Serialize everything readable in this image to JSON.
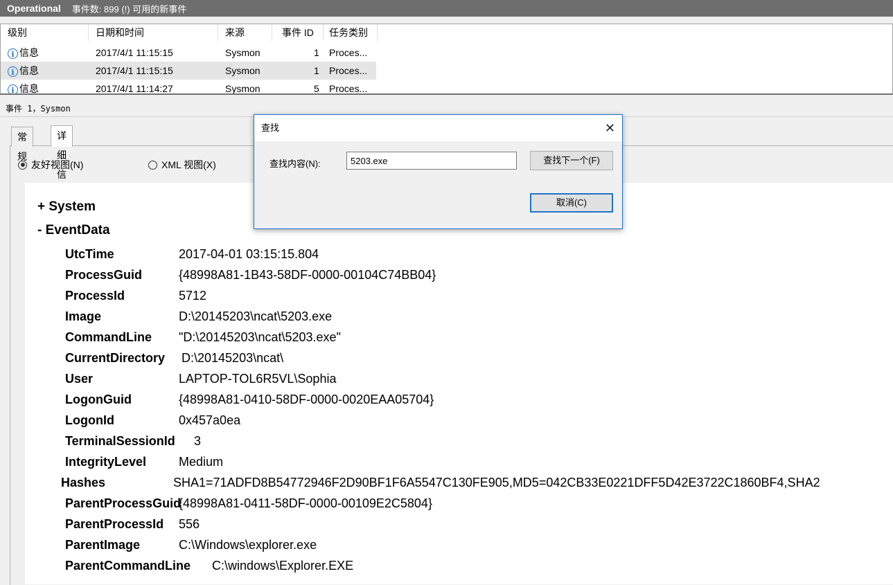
{
  "titlebar": {
    "log_name": "Operational",
    "summary": "事件数: 899 (!) 可用的新事件"
  },
  "list": {
    "columns": [
      "级别",
      "日期和时间",
      "来源",
      "事件 ID",
      "任务类别"
    ],
    "rows": [
      {
        "level": "信息",
        "datetime": "2017/4/1 11:15:15",
        "source": "Sysmon",
        "id": "1",
        "task": "Proces..."
      },
      {
        "level": "信息",
        "datetime": "2017/4/1 11:15:15",
        "source": "Sysmon",
        "id": "1",
        "task": "Proces..."
      },
      {
        "level": "信息",
        "datetime": "2017/4/1 11:14:27",
        "source": "Sysmon",
        "id": "5",
        "task": "Proces..."
      }
    ]
  },
  "detail": {
    "header": "事件 1，Sysmon",
    "tabs": [
      "常规",
      "详细信息"
    ],
    "views": {
      "friendly": "友好视图(N)",
      "xml": "XML 视图(X)"
    },
    "sections": {
      "system": "+ System",
      "eventdata": "-  EventData"
    },
    "fields": [
      {
        "k": "UtcTime",
        "v": "2017-04-01 03:15:15.804"
      },
      {
        "k": "ProcessGuid",
        "v": "{48998A81-1B43-58DF-0000-00104C74BB04}"
      },
      {
        "k": "ProcessId",
        "v": "5712"
      },
      {
        "k": "Image",
        "v": "D:\\20145203\\ncat\\5203.exe"
      },
      {
        "k": "CommandLine",
        "v": "\"D:\\20145203\\ncat\\5203.exe\""
      },
      {
        "k": "CurrentDirectory",
        "v": "D:\\20145203\\ncat\\"
      },
      {
        "k": "User",
        "v": "LAPTOP-TOL6R5VL\\Sophia"
      },
      {
        "k": "LogonGuid",
        "v": "{48998A81-0410-58DF-0000-0020EAA05704}"
      },
      {
        "k": "LogonId",
        "v": "0x457a0ea"
      },
      {
        "k": "TerminalSessionId",
        "v": "3"
      },
      {
        "k": "IntegrityLevel",
        "v": "Medium"
      },
      {
        "k": "Hashes",
        "v": "SHA1=71ADFD8B54772946F2D90BF1F6A5547C130FE905,MD5=042CB33E0221DFF5D42E3722C1860BF4,SHA2"
      },
      {
        "k": "ParentProcessGuid",
        "v": "{48998A81-0411-58DF-0000-00109E2C5804}"
      },
      {
        "k": "ParentProcessId",
        "v": "556"
      },
      {
        "k": "ParentImage",
        "v": "C:\\Windows\\explorer.exe"
      },
      {
        "k": "ParentCommandLine",
        "v": "C:\\windows\\Explorer.EXE"
      }
    ]
  },
  "find_dialog": {
    "title": "查找",
    "label": "查找内容(N):",
    "value": "5203.exe",
    "find_next": "查找下一个(F)",
    "cancel": "取消(C)"
  },
  "icons": {
    "info": "info-icon",
    "close": "close-icon"
  },
  "colors": {
    "titlebar": "#6e6e6e",
    "accent": "#1e73c8"
  }
}
